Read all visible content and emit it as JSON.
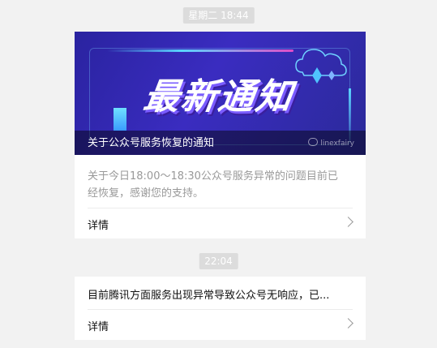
{
  "timestamps": [
    "星期二  18:44",
    "22:04"
  ],
  "messages": [
    {
      "banner": {
        "title": "最新通知",
        "caption": "关于公众号服务恢复的通知",
        "watermark": "linexfairy",
        "colors": {
          "bg": "#2a23a0",
          "accent_cyan": "#5ad6ff",
          "accent_pink": "#e14cc8"
        }
      },
      "description": "关于今日18:00～18:30公众号服务异常的问题目前已经恢复，感谢您的支持。",
      "details_label": "详情"
    },
    {
      "text": "目前腾讯方面服务出现异常导致公众号无响应，已...",
      "details_label": "详情"
    }
  ],
  "icons": {
    "details_chevron": "chevron-right-icon",
    "watermark_icon": "wechat-icon"
  }
}
